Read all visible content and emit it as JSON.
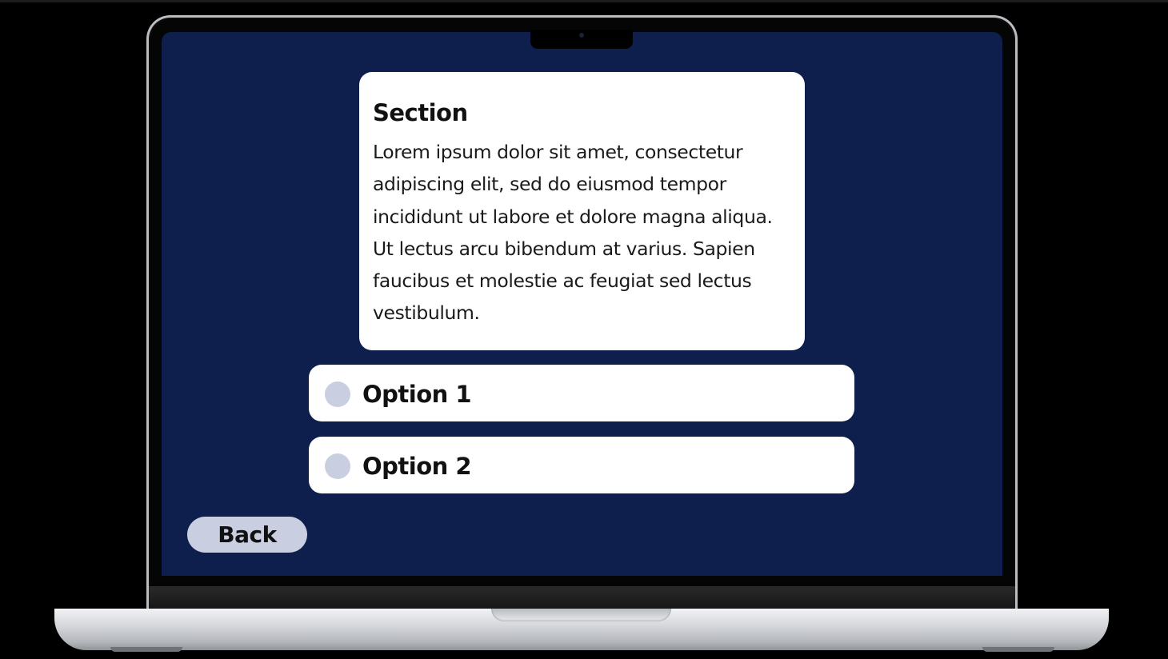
{
  "section": {
    "title": "Section",
    "body": "Lorem ipsum dolor sit amet, consectetur adipiscing elit, sed do eiusmod tempor incididunt ut labore et dolore magna aliqua. Ut lectus arcu bibendum at varius. Sapien faucibus et molestie ac feugiat sed lectus vestibulum."
  },
  "options": [
    {
      "label": "Option 1",
      "selected": false
    },
    {
      "label": "Option 2",
      "selected": false
    }
  ],
  "navigation": {
    "back_label": "Back"
  },
  "colors": {
    "screen_background": "#0e1f4d",
    "card_background": "#ffffff",
    "radio_fill": "#c9cfe0",
    "back_button_fill": "#c9cfe0",
    "text": "#111111"
  },
  "icons": {
    "option_marker": "radio-circle-icon",
    "camera": "camera-icon"
  }
}
